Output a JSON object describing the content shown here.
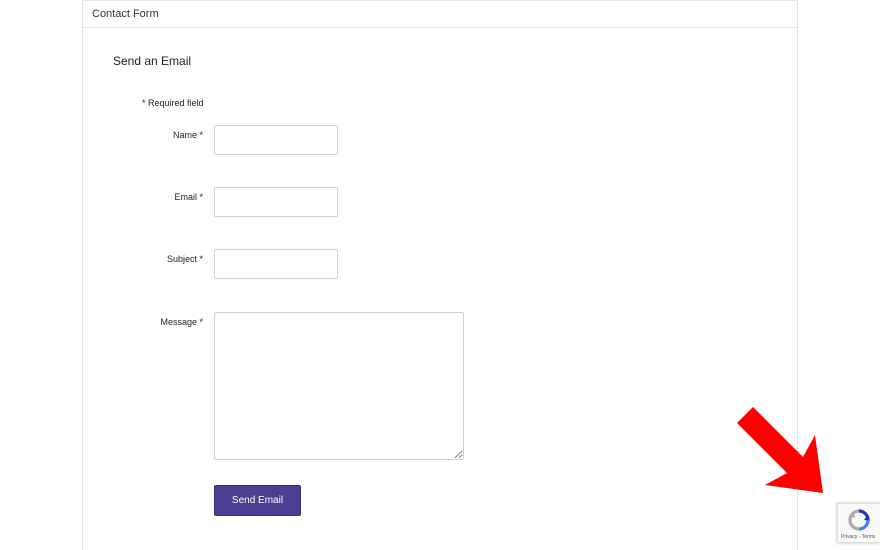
{
  "panel": {
    "header_title": "Contact Form"
  },
  "form": {
    "section_title": "Send an Email",
    "required_note": "* Required field",
    "fields": {
      "name": {
        "label": "Name *",
        "value": "",
        "placeholder": ""
      },
      "email": {
        "label": "Email *",
        "value": "",
        "placeholder": ""
      },
      "subject": {
        "label": "Subject *",
        "value": "",
        "placeholder": ""
      },
      "message": {
        "label": "Message *",
        "value": "",
        "placeholder": ""
      }
    },
    "submit_label": "Send Email"
  },
  "recaptcha": {
    "links_text": "Privacy - Terms",
    "icon": "recaptcha-icon"
  },
  "annotation": {
    "icon": "red-arrow-icon",
    "color": "#ff0000"
  },
  "colors": {
    "button_bg": "#4b3f93",
    "border": "#cfcfcf"
  }
}
